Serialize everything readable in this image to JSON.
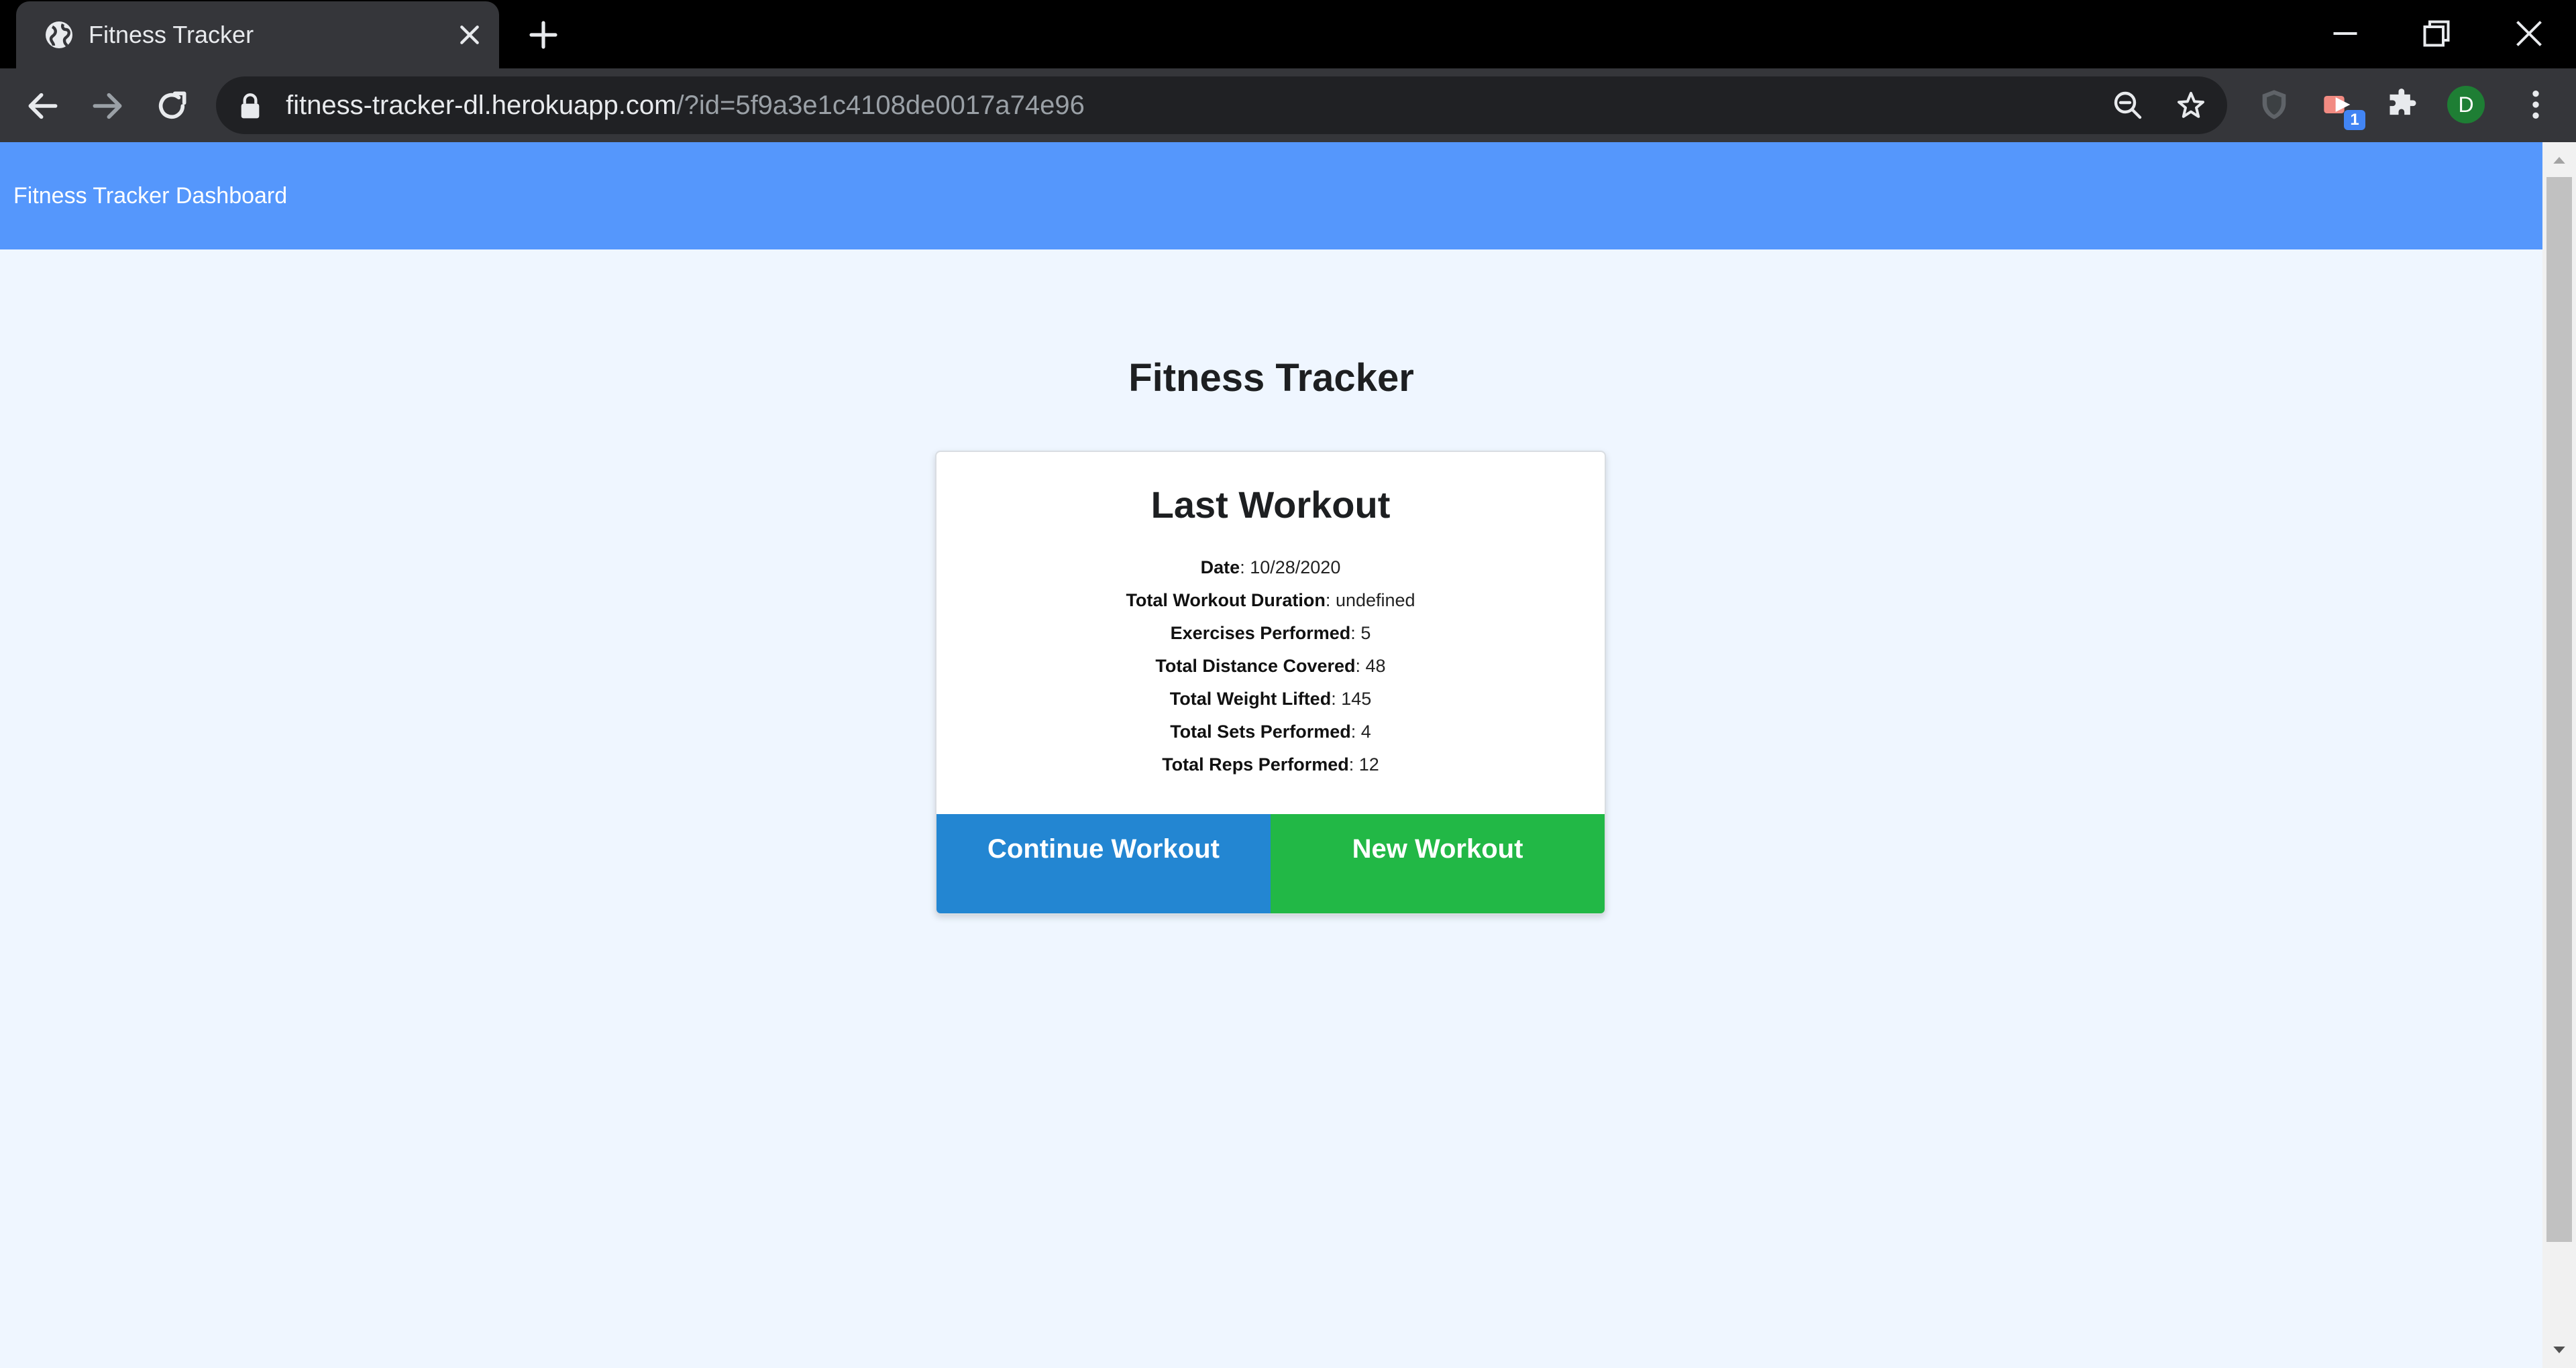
{
  "browser": {
    "tab_title": "Fitness Tracker",
    "url_host": "fitness-tracker-dl.herokuapp.com",
    "url_path": "/?id=5f9a3e1c4108de0017a74e96",
    "extension_badge": "1",
    "profile_initial": "D",
    "icons": [
      "globe-icon",
      "close-icon",
      "plus-icon",
      "minimize-icon",
      "restore-icon",
      "window-close-icon",
      "back-arrow-icon",
      "forward-arrow-icon",
      "reload-icon",
      "lock-icon",
      "zoom-out-icon",
      "star-icon",
      "shield-icon",
      "extension-icon",
      "puzzle-icon",
      "menu-dots-icon"
    ]
  },
  "navbar": {
    "brand": "Fitness Tracker Dashboard",
    "background": "#5597fc"
  },
  "main": {
    "title": "Fitness Tracker",
    "card": {
      "title": "Last Workout",
      "stats": [
        {
          "label": "Date",
          "value": "10/28/2020"
        },
        {
          "label": "Total Workout Duration",
          "value": "undefined"
        },
        {
          "label": "Exercises Performed",
          "value": "5"
        },
        {
          "label": "Total Distance Covered",
          "value": "48"
        },
        {
          "label": "Total Weight Lifted",
          "value": "145"
        },
        {
          "label": "Total Sets Performed",
          "value": "4"
        },
        {
          "label": "Total Reps Performed",
          "value": "12"
        }
      ],
      "continue_button": "Continue Workout",
      "new_button": "New Workout"
    }
  },
  "colors": {
    "continue": "#2386d2",
    "new": "#22b846",
    "page_background": "#eff6ff"
  }
}
